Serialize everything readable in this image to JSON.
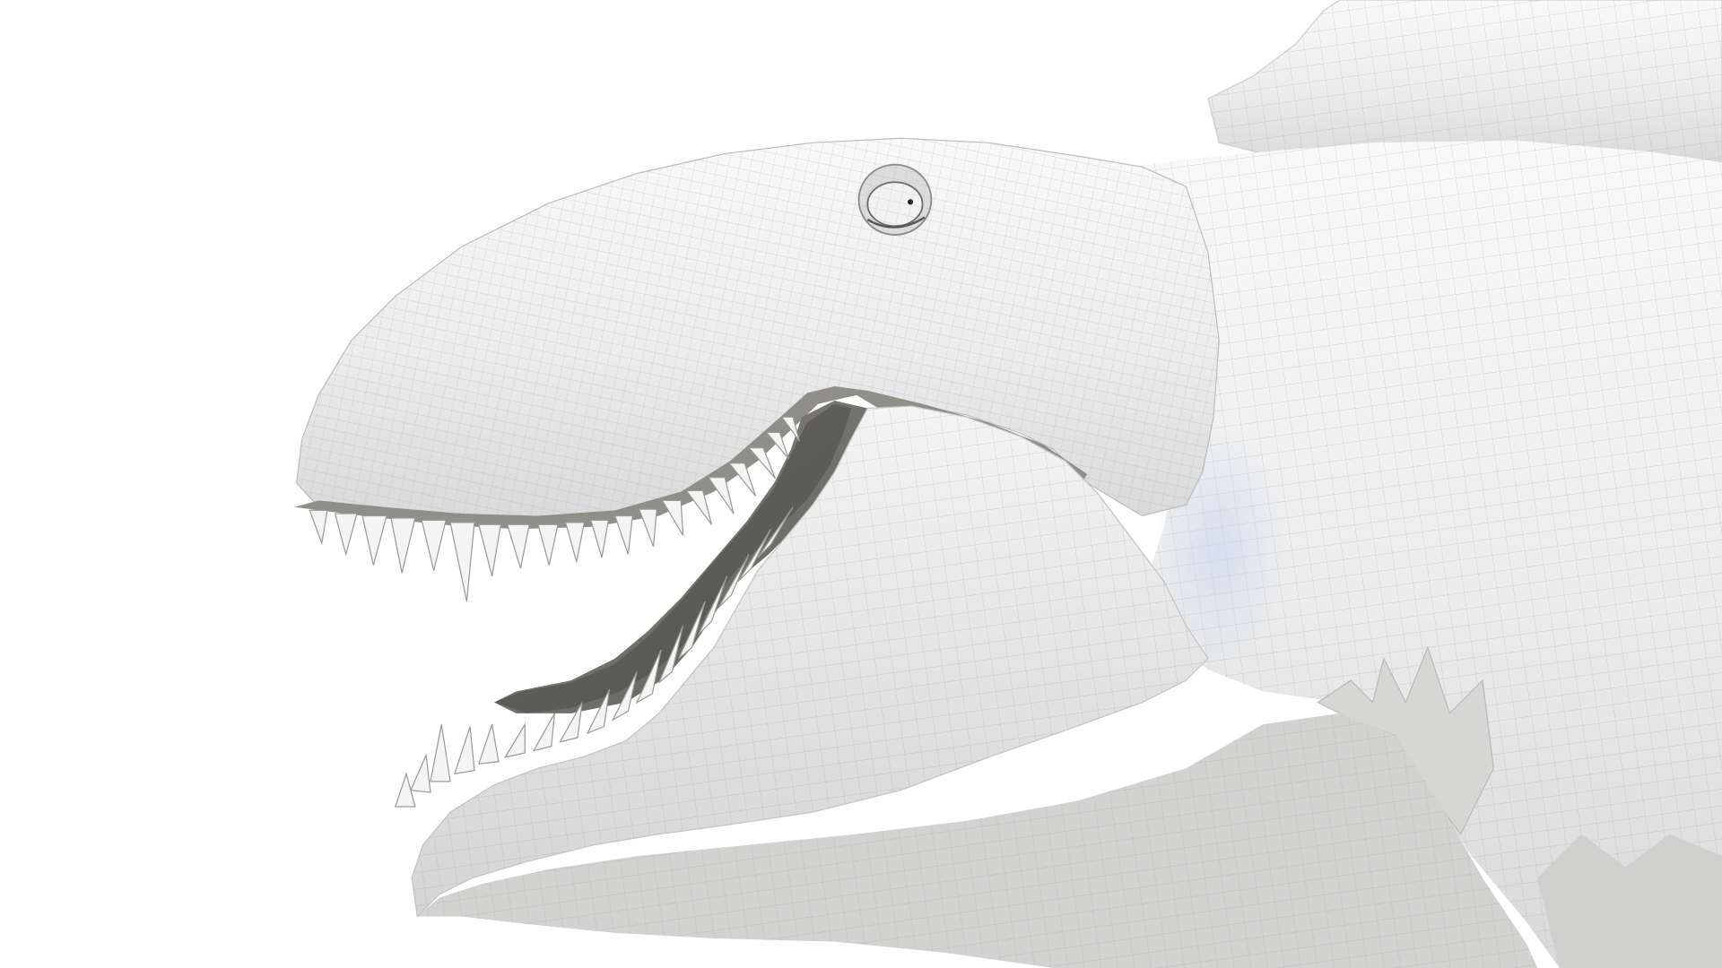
{
  "scene": {
    "subject": "dinosaur-head-wireframe-render",
    "background_color": "#ffffff",
    "skin_color": "#eeeeee",
    "shadow_color": "#7a7a78",
    "mouth_interior_color": "#6f6e68",
    "wire_color": "#9aa0a6",
    "tooth_color": "#f4f4f4",
    "highlight_color": "#c9d6ee",
    "icons": [
      "dinosaur-head-icon",
      "eye-icon",
      "teeth-icon",
      "back-sail-icon"
    ]
  }
}
